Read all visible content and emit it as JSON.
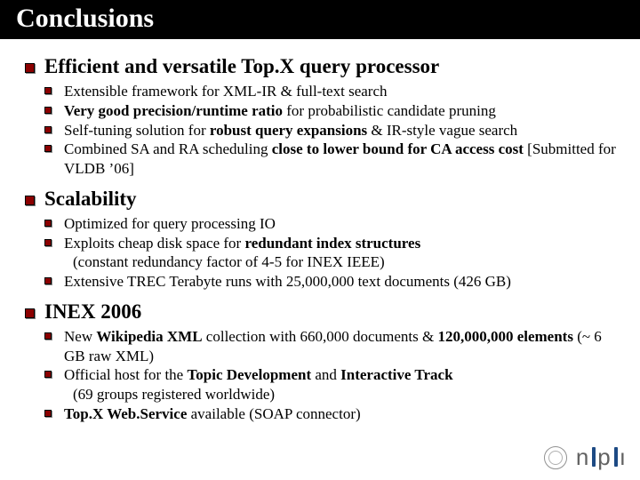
{
  "title": "Conclusions",
  "sections": [
    {
      "heading": "Efficient and versatile Top.X query processor",
      "items": [
        {
          "html": "Extensible framework for XML-IR & full-text search"
        },
        {
          "html": "<span class='b'>Very good precision/runtime ratio</span> for probabilistic candidate pruning"
        },
        {
          "html": "Self-tuning solution for <span class='b'>robust query expansions</span> & IR-style vague search"
        },
        {
          "html": "Combined SA and RA scheduling <span class='b'>close to lower bound for CA access cost</span> [Submitted for VLDB ’06]"
        }
      ]
    },
    {
      "heading": "Scalability",
      "items": [
        {
          "html": "Optimized for query processing IO"
        },
        {
          "html": "Exploits cheap disk space for <span class='b'>redundant index structures</span><span class='sub'>(constant redundancy factor of 4-5 for INEX IEEE)</span>"
        },
        {
          "html": "Extensive TREC Terabyte runs with 25,000,000 text documents (426 GB)"
        }
      ]
    },
    {
      "heading": "INEX 2006",
      "items": [
        {
          "html": "New <span class='b'>Wikipedia XML</span> collection with 660,000 documents & <span class='b'>120,000,000 elements</span> (~ 6 GB raw XML)"
        },
        {
          "html": "Official host for the <span class='b'>Topic Development</span> and <span class='b'>Interactive Track</span><span class='sub'>(69 groups registered worldwide)</span>"
        },
        {
          "html": "<span class='b'>Top.X Web.Service</span> available (SOAP connector)"
        }
      ]
    }
  ],
  "logo": {
    "text": "mpii"
  }
}
